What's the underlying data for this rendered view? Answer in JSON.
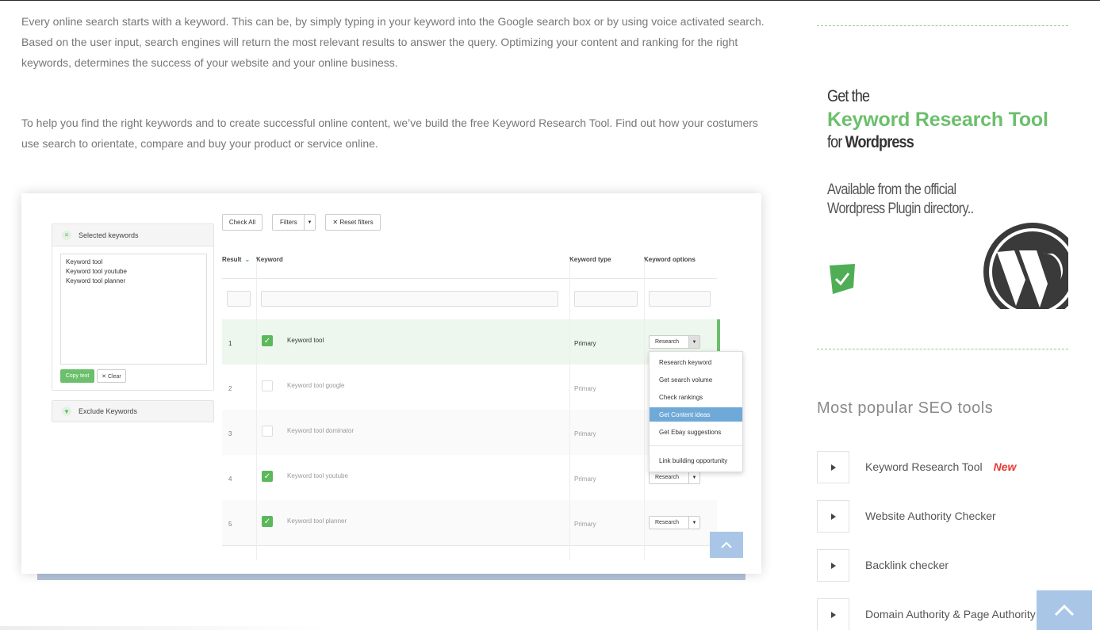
{
  "article": {
    "paragraph1": "Every online search starts with a keyword. This can be, by simply typing in your keyword into the Google search box or by using voice activated search. Based on the user input, search engines will return the most relevant results to answer the query. Optimizing your content and ranking for the right keywords, determines the success of your website and your online business.",
    "paragraph2": "To help you find the right keywords and to create successful online content, we’ve build the free Keyword Research Tool. Find out how your costumers use search to orientate, compare and buy your product or service online."
  },
  "screenshot": {
    "selected_panel_title": "Selected keywords",
    "selected_keywords": [
      "Keyword tool",
      "Keyword tool youtube",
      "Keyword tool planner"
    ],
    "copy_label": "Copy text",
    "clear_label": "✕ Clear",
    "exclude_panel_title": "Exclude Keywords",
    "toolbar": {
      "check_all": "Check All",
      "filters": "Filters",
      "reset": "✕ Reset filters"
    },
    "columns": {
      "result": "Result",
      "keyword": "Keyword",
      "type": "Keyword type",
      "options": "Keyword options"
    },
    "rows": [
      {
        "num": "1",
        "keyword": "Keyword tool",
        "type": "Primary",
        "checked": true,
        "option": "Research"
      },
      {
        "num": "2",
        "keyword": "Keyword tool google",
        "type": "Primary",
        "checked": false,
        "option": ""
      },
      {
        "num": "3",
        "keyword": "Keyword tool dominator",
        "type": "Primary",
        "checked": false,
        "option": ""
      },
      {
        "num": "4",
        "keyword": "Keyword tool youtube",
        "type": "Primary",
        "checked": true,
        "option": "Research"
      },
      {
        "num": "5",
        "keyword": "Keyword tool planner",
        "type": "Primary",
        "checked": true,
        "option": "Research"
      }
    ],
    "dropdown": [
      "Research keyword",
      "Get search volume",
      "Check rankings",
      "Get Content ideas",
      "Get Ebay suggestions",
      "Link building opportunity"
    ],
    "dropdown_highlight": "Get Content ideas"
  },
  "promo": {
    "line1": "Get the",
    "title": "Keyword Research Tool",
    "for_text": "for ",
    "platform": "Wordpress",
    "avail1": "Available from the official",
    "avail2": "Wordpress Plugin directory.."
  },
  "sidebar": {
    "heading": "Most popular SEO tools",
    "tools": [
      {
        "label": "Keyword Research Tool",
        "badge": "New"
      },
      {
        "label": "Website Authority Checker",
        "badge": ""
      },
      {
        "label": "Backlink checker",
        "badge": ""
      },
      {
        "label": "Domain Authority & Page Authority",
        "badge": ""
      }
    ]
  },
  "colors": {
    "accent_green": "#6cbf6c",
    "scroll_blue": "#a9c6e6",
    "new_red": "#e53935"
  },
  "icons": [
    "list-icon",
    "filter-icon",
    "check-icon",
    "caret-down-icon",
    "chevron-up-icon",
    "caret-right-icon",
    "wordpress-logo"
  ]
}
